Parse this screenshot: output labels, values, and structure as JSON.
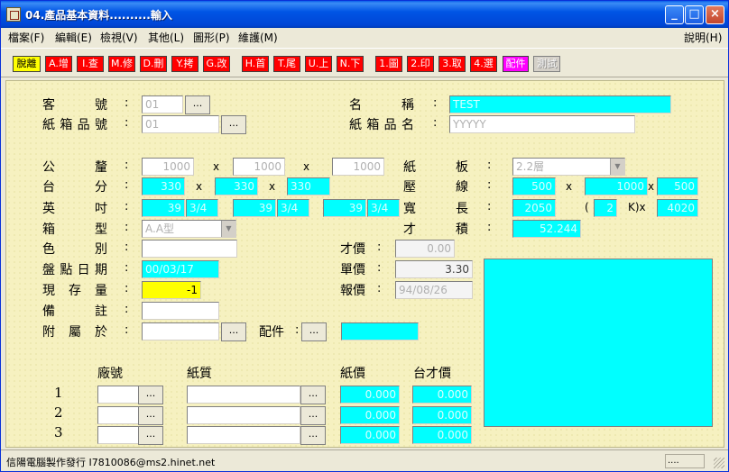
{
  "window": {
    "title": "04.產品基本資料..........輸入"
  },
  "menu": [
    "檔案(F)",
    "編輯(E)",
    "檢視(V)",
    "其他(L)",
    "圖形(P)",
    "維護(M)"
  ],
  "menu_help": "說明(H)",
  "toolbar": [
    "脫離",
    "A.增",
    "I.查",
    "M.修",
    "D.刪",
    "Y.拷",
    "G.改",
    "H.首",
    "T.尾",
    "U.上",
    "N.下",
    "1.圖",
    "2.印",
    "3.取",
    "4.選",
    "配件",
    "測試"
  ],
  "labels": {
    "customer_no": "客 號",
    "box_item_no": "紙箱品號",
    "name": "名 稱",
    "box_item_name": "紙箱品名",
    "metric": "公 釐",
    "tai_fen": "台 分",
    "inch": "英 吋",
    "box_type": "箱 型",
    "color": "色 別",
    "inventory_date": "盤點日期",
    "stock": "現 存 量",
    "note": "備 註",
    "attached_to": "附 屬 於",
    "parts": "配件",
    "board": "紙 板",
    "crease": "壓 線",
    "width_length": "寬 長",
    "area": "才 積",
    "price_per_cai": "才價",
    "unit_price": "單價",
    "quote": "報價",
    "factory_no": "廠號",
    "paper_quality": "紙質",
    "paper_price": "紙價",
    "tai_cai_price": "台才價"
  },
  "colon": ":",
  "x_sign": "x",
  "k_open": "(",
  "k_close": "K)x",
  "ellipsis": "...",
  "values": {
    "customer_no": "01",
    "box_item_no": "01",
    "name": "TEST",
    "box_item_name": "YYYYY",
    "mm1": "1000",
    "mm2": "1000",
    "mm3": "1000",
    "board": "2.2層",
    "box_type": "A.A型",
    "tf1": "330",
    "tf2": "330",
    "tf3": "330",
    "in1": "39",
    "in1f": "3/4",
    "in2": "39",
    "in2f": "3/4",
    "in3": "39",
    "in3f": "3/4",
    "crease1": "500",
    "crease2": "1000",
    "crease3": "500",
    "width": "2050",
    "k": "2",
    "length": "4020",
    "area": "52.244",
    "price_per_cai": "0.00",
    "inventory_date": "00/03/17",
    "unit_price": "3.30",
    "stock": "-1",
    "quote": "94/08/26",
    "row_paper_price": "0.000",
    "row_tai_cai_price": "0.000"
  },
  "row_numbers": [
    "1",
    "2",
    "3"
  ],
  "status": {
    "text": "信陽電腦製作發行 I7810086@ms2.hinet.net",
    "box": "...."
  },
  "colors": {
    "cyan": "#00ffff",
    "yellow": "#ffff00",
    "form_bg": "#f6f1c0",
    "title_blue": "#0055e5"
  }
}
